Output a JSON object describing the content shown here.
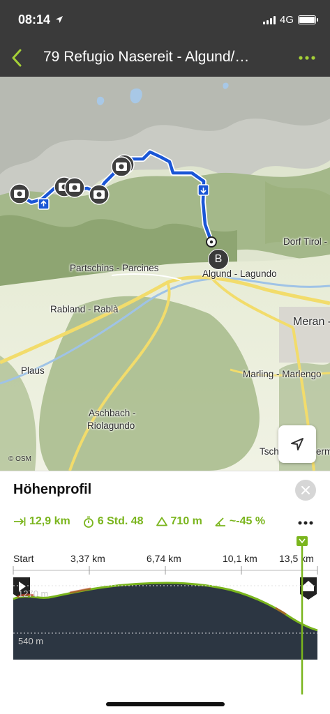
{
  "status_bar": {
    "time": "08:14",
    "network": "4G"
  },
  "nav": {
    "title": "79 Refugio Nasereit - Algund/…"
  },
  "map": {
    "labels": {
      "partschins": "Partschins - Parcines",
      "algund": "Algund - Lagundo",
      "dorf_tirol": "Dorf Tirol -",
      "rabland": "Rabland - Rablà",
      "meran": "Meran -",
      "plaus": "Plaus",
      "marling": "Marling - Marlengo",
      "aschbach_1": "Aschbach -",
      "aschbach_2": "Riolagundo",
      "tscherms": "Tsch",
      "tscherms_2": "erm"
    },
    "marker_end": "B",
    "attribution": "© OSM"
  },
  "profile": {
    "title": "Höhenprofil",
    "distance": "12,9 km",
    "duration": "6 Std. 48",
    "ascent": "710 m",
    "gradient": "~-45 %",
    "x_ticks": [
      "Start",
      "3,37 km",
      "6,74 km",
      "10,1 km",
      "13,5 km"
    ],
    "y_ticks": [
      "1270 m",
      "540 m"
    ]
  },
  "colors": {
    "accent": "#7ab51d",
    "route": "#1a56d6",
    "profile_fill": "#2c3642"
  }
}
